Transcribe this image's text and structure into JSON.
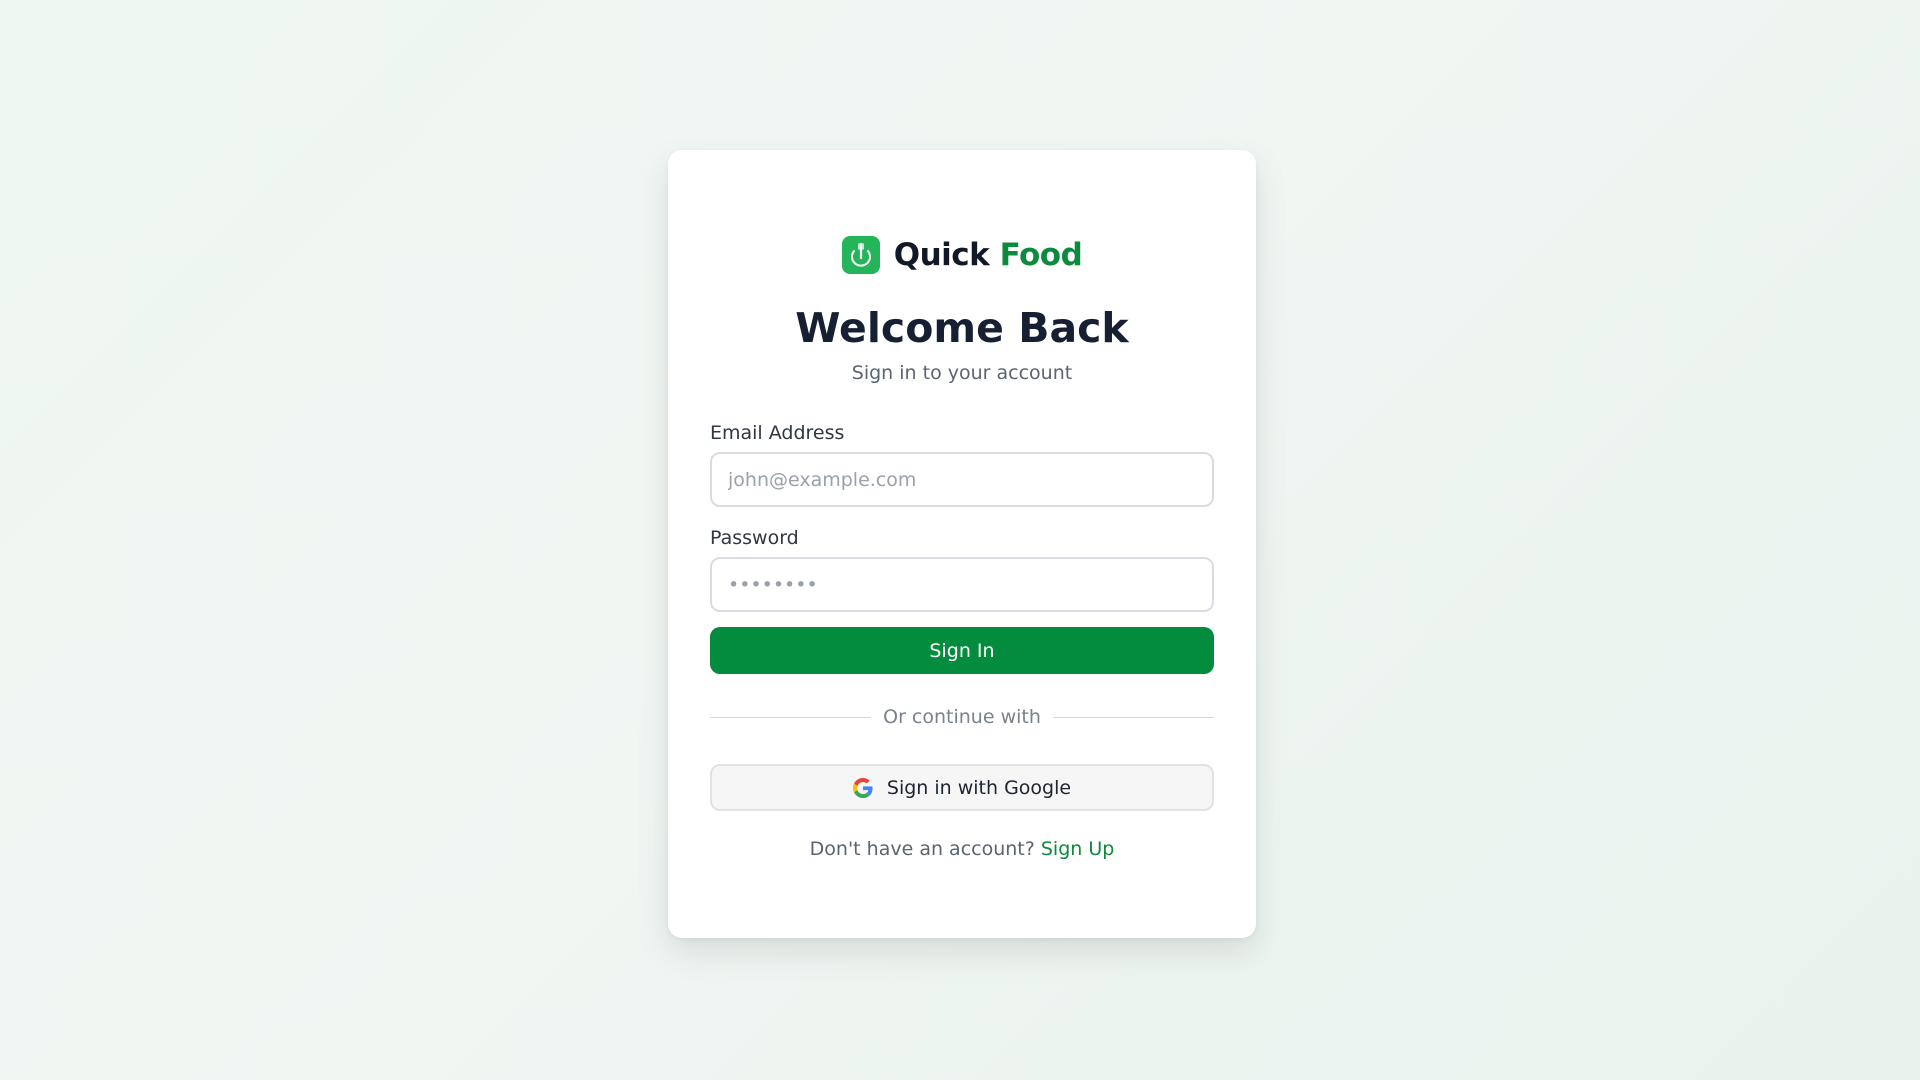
{
  "brand": {
    "name_part1": "Quick",
    "name_part2": "Food",
    "icon": "utensils-icon",
    "accent_color": "#0e8a3e",
    "icon_bg_color": "#24b45a"
  },
  "header": {
    "title": "Welcome Back",
    "subtitle": "Sign in to your account"
  },
  "form": {
    "email_label": "Email Address",
    "email_placeholder": "john@example.com",
    "email_value": "",
    "password_label": "Password",
    "password_placeholder": "••••••••",
    "password_value": "",
    "submit_label": "Sign In",
    "primary_color": "#038c3e"
  },
  "divider": {
    "text": "Or continue with"
  },
  "google": {
    "label": "Sign in with Google",
    "icon": "google-icon"
  },
  "footer": {
    "prompt": "Don't have an account?",
    "link_label": "Sign Up"
  }
}
